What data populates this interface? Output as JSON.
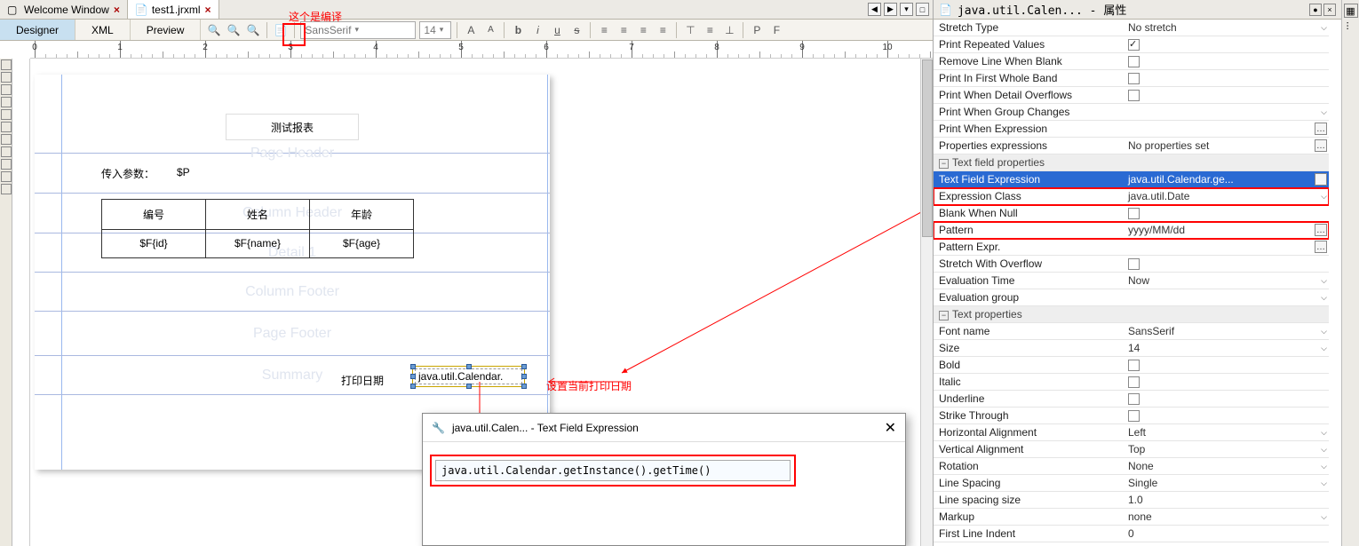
{
  "tabs": {
    "welcome": "Welcome Window",
    "file": "test1.jrxml"
  },
  "annot_compile": "这个是编译",
  "modes": {
    "designer": "Designer",
    "xml": "XML",
    "preview": "Preview"
  },
  "toolbar": {
    "font": "SansSerif",
    "size": "14"
  },
  "ruler_ticks": [
    "0",
    "1",
    "2",
    "3",
    "4",
    "5",
    "6",
    "7",
    "8",
    "9",
    "10"
  ],
  "report": {
    "title": "测试报表",
    "param_label": "传入参数：",
    "param_value": "$P",
    "cols": [
      "编号",
      "姓名",
      "年龄"
    ],
    "fields": [
      "$F{id}",
      "$F{name}",
      "$F{age}"
    ],
    "bands": {
      "pageHeader": "Page Header",
      "columnHeader": "Column Header",
      "detail": "Detail 1",
      "columnFooter": "Column Footer",
      "pageFooter": "Page Footer",
      "summary": "Summary"
    },
    "summary_label": "打印日期",
    "summary_field": "java.util.Calendar."
  },
  "annot_set": "设置当前打印日期",
  "dialog": {
    "title": "java.util.Calen... - Text Field Expression",
    "value": "java.util.Calendar.getInstance().getTime()"
  },
  "props": {
    "title": "java.util.Calen... - 属性",
    "rows": [
      {
        "l": "Stretch Type",
        "v": "No stretch",
        "t": "dd"
      },
      {
        "l": "Print Repeated Values",
        "v": "",
        "t": "chkon"
      },
      {
        "l": "Remove Line When Blank",
        "v": "",
        "t": "chk"
      },
      {
        "l": "Print In First Whole Band",
        "v": "",
        "t": "chk"
      },
      {
        "l": "Print When Detail Overflows",
        "v": "",
        "t": "chk"
      },
      {
        "l": "Print When Group Changes",
        "v": "",
        "t": "dd"
      },
      {
        "l": "Print When Expression",
        "v": "",
        "t": "edot"
      },
      {
        "l": "Properties expressions",
        "v": "No properties set",
        "t": "edot"
      },
      {
        "l": "Text field properties",
        "v": "",
        "t": "cat"
      },
      {
        "l": "Text Field Expression",
        "v": "java.util.Calendar.ge...",
        "t": "edot",
        "sel": true
      },
      {
        "l": "Expression Class",
        "v": "java.util.Date",
        "t": "dd",
        "hl": true
      },
      {
        "l": "Blank When Null",
        "v": "",
        "t": "chk"
      },
      {
        "l": "Pattern",
        "v": "yyyy/MM/dd",
        "t": "edot",
        "hl": true
      },
      {
        "l": "Pattern Expr.",
        "v": "",
        "t": "edot"
      },
      {
        "l": "Stretch With Overflow",
        "v": "",
        "t": "chk"
      },
      {
        "l": "Evaluation Time",
        "v": "Now",
        "t": "dd"
      },
      {
        "l": "Evaluation group",
        "v": "",
        "t": "dd"
      },
      {
        "l": "Text properties",
        "v": "",
        "t": "cat"
      },
      {
        "l": "Font name",
        "v": "SansSerif",
        "t": "dd"
      },
      {
        "l": "Size",
        "v": "14",
        "t": "dd"
      },
      {
        "l": "Bold",
        "v": "",
        "t": "chk"
      },
      {
        "l": "Italic",
        "v": "",
        "t": "chk"
      },
      {
        "l": "Underline",
        "v": "",
        "t": "chk"
      },
      {
        "l": "Strike Through",
        "v": "",
        "t": "chk"
      },
      {
        "l": "Horizontal Alignment",
        "v": "Left",
        "t": "dd"
      },
      {
        "l": "Vertical Alignment",
        "v": "Top",
        "t": "dd"
      },
      {
        "l": "Rotation",
        "v": "None",
        "t": "dd"
      },
      {
        "l": "Line Spacing",
        "v": "Single",
        "t": "dd"
      },
      {
        "l": "Line spacing size",
        "v": "1.0",
        "t": "txt"
      },
      {
        "l": "Markup",
        "v": "none",
        "t": "dd"
      },
      {
        "l": "First Line Indent",
        "v": "0",
        "t": "txt"
      }
    ]
  }
}
